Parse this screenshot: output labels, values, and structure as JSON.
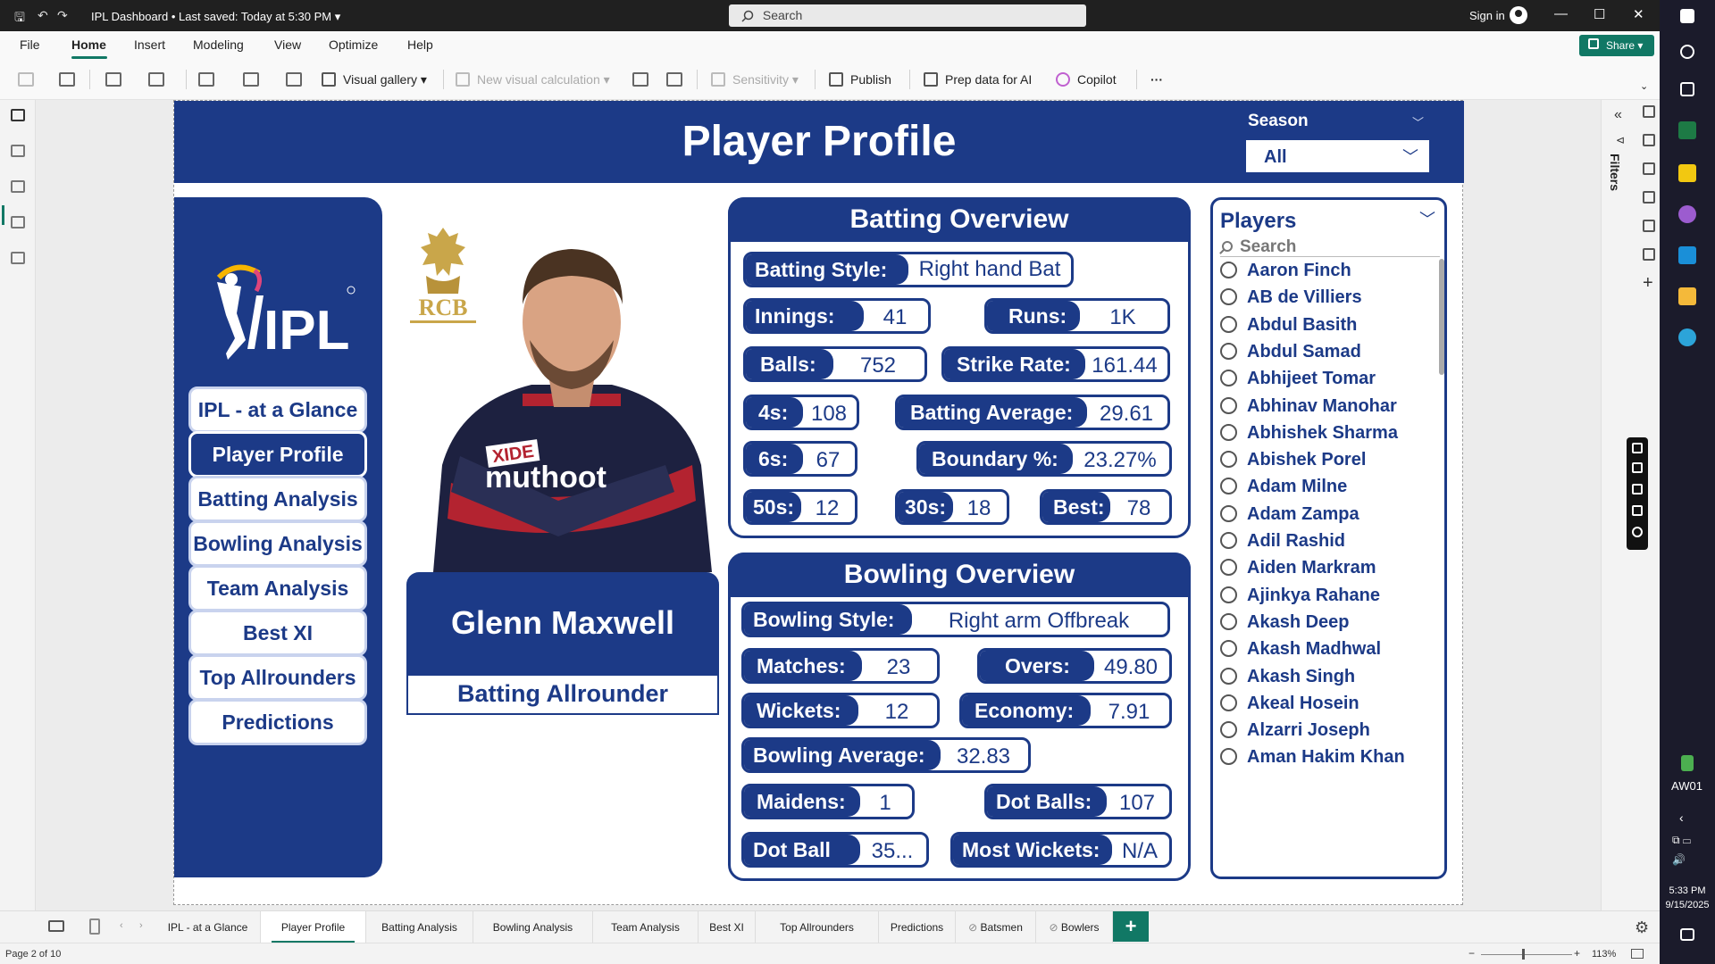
{
  "titlebar": {
    "title": "IPL Dashboard",
    "saved": "Last saved: Today at 5:30 PM",
    "search_placeholder": "Search",
    "signin": "Sign in"
  },
  "ribbon": {
    "tabs": [
      "File",
      "Home",
      "Insert",
      "Modeling",
      "View",
      "Optimize",
      "Help"
    ],
    "active_tab": "Home",
    "share": "Share",
    "tools": {
      "visual_gallery": "Visual gallery",
      "new_visual_calculation": "New visual calculation",
      "sensitivity": "Sensitivity",
      "publish": "Publish",
      "prep_data": "Prep data for AI",
      "copilot": "Copilot",
      "more": "···"
    }
  },
  "report": {
    "title": "Player Profile",
    "season": {
      "label": "Season",
      "value": "All"
    },
    "nav": [
      "IPL - at a Glance",
      "Player Profile",
      "Batting Analysis",
      "Bowling Analysis",
      "Team Analysis",
      "Best XI",
      "Top Allrounders",
      "Predictions"
    ],
    "active_nav": "Player Profile",
    "player": {
      "name": "Glenn Maxwell",
      "role": "Batting Allrounder",
      "team_logo_text": "RCB",
      "jersey_text_1": "XIDE",
      "jersey_text_2": "muthoot"
    },
    "batting": {
      "title": "Batting Overview",
      "style_label": "Batting Style:",
      "style": "Right hand Bat",
      "innings_label": "Innings:",
      "innings": "41",
      "runs_label": "Runs:",
      "runs": "1K",
      "balls_label": "Balls:",
      "balls": "752",
      "sr_label": "Strike Rate:",
      "sr": "161.44",
      "fours_label": "4s:",
      "fours": "108",
      "avg_label": "Batting Average:",
      "avg": "29.61",
      "sixes_label": "6s:",
      "sixes": "67",
      "boundary_label": "Boundary %:",
      "boundary": "23.27%",
      "fifties_label": "50s:",
      "fifties": "12",
      "thirties_label": "30s:",
      "thirties": "18",
      "best_label": "Best:",
      "best": "78"
    },
    "bowling": {
      "title": "Bowling Overview",
      "style_label": "Bowling Style:",
      "style": "Right arm Offbreak",
      "matches_label": "Matches:",
      "matches": "23",
      "overs_label": "Overs:",
      "overs": "49.80",
      "wickets_label": "Wickets:",
      "wickets": "12",
      "economy_label": "Economy:",
      "economy": "7.91",
      "avg_label": "Bowling Average:",
      "avg": "32.83",
      "maidens_label": "Maidens:",
      "maidens": "1",
      "dots_label": "Dot Balls:",
      "dots": "107",
      "dotpct_label": "Dot Ball %:",
      "dotpct": "35...",
      "mostw_label": "Most Wickets:",
      "mostw": "N/A"
    },
    "players": {
      "title": "Players",
      "search_placeholder": "Search",
      "items": [
        "Aaron Finch",
        "AB de Villiers",
        "Abdul Basith",
        "Abdul Samad",
        "Abhijeet Tomar",
        "Abhinav Manohar",
        "Abhishek Sharma",
        "Abishek Porel",
        "Adam Milne",
        "Adam Zampa",
        "Adil Rashid",
        "Aiden Markram",
        "Ajinkya Rahane",
        "Akash Deep",
        "Akash Madhwal",
        "Akash Singh",
        "Akeal Hosein",
        "Alzarri Joseph",
        "Aman Hakim Khan"
      ]
    }
  },
  "filters_label": "Filters",
  "page_tabs": [
    "IPL - at a Glance",
    "Player Profile",
    "Batting Analysis",
    "Bowling Analysis",
    "Team Analysis",
    "Best XI",
    "Top Allrounders",
    "Predictions",
    "Batsmen",
    "Bowlers"
  ],
  "status": {
    "page": "Page 2 of 10",
    "zoom": "113%"
  },
  "taskbar": {
    "network": "AW01",
    "time": "5:33 PM",
    "date": "9/15/2025"
  },
  "colors": {
    "brand": "#1c3a87",
    "accent": "#117865"
  }
}
